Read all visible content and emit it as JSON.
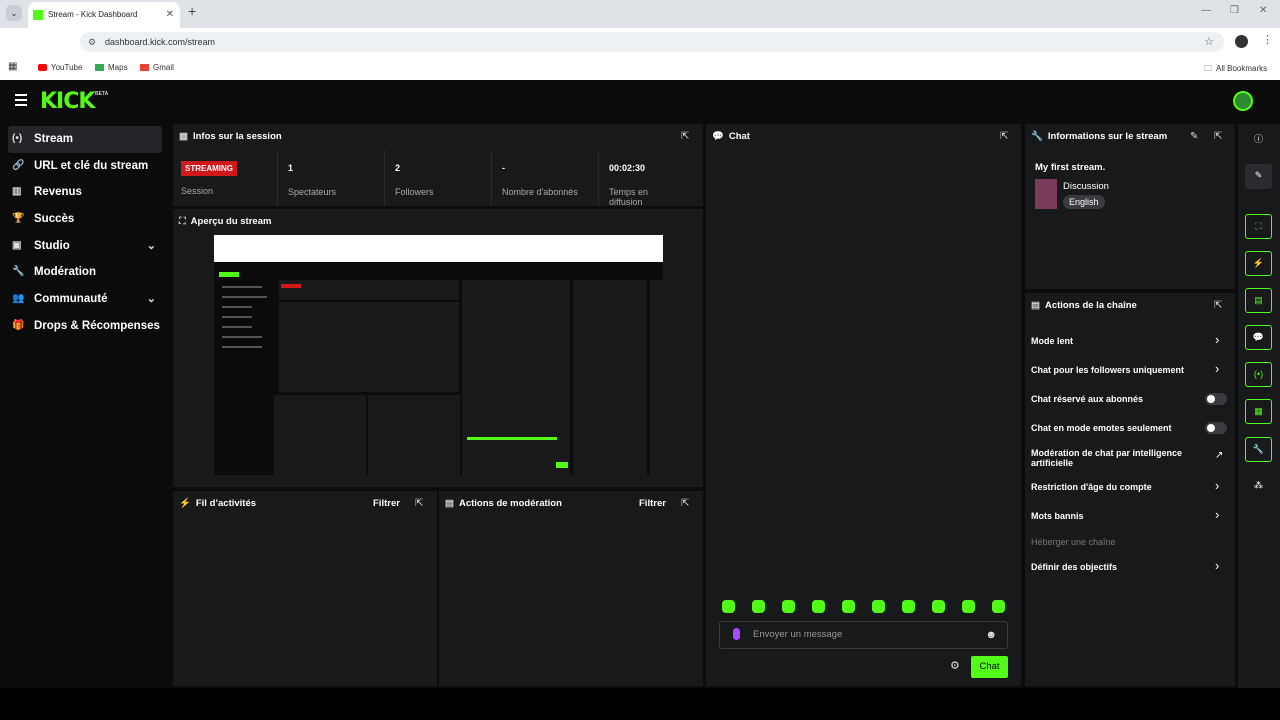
{
  "browser": {
    "tab_title": "Stream - Kick Dashboard",
    "url": "dashboard.kick.com/stream",
    "bookmarks": [
      "YouTube",
      "Maps",
      "Gmail"
    ],
    "all_bookmarks": "All Bookmarks"
  },
  "brand": {
    "logo": "KICK",
    "beta": "BETA",
    "accent": "#53fc18"
  },
  "sidebar": {
    "items": [
      {
        "label": "Stream",
        "icon": "broadcast-icon"
      },
      {
        "label": "URL et clé du stream",
        "icon": "link-icon"
      },
      {
        "label": "Revenus",
        "icon": "chart-icon"
      },
      {
        "label": "Succès",
        "icon": "trophy-icon"
      },
      {
        "label": "Studio",
        "icon": "studio-icon"
      },
      {
        "label": "Modération",
        "icon": "wrench-icon"
      },
      {
        "label": "Communauté",
        "icon": "community-icon"
      },
      {
        "label": "Drops & Récompenses",
        "icon": "gift-icon"
      }
    ]
  },
  "session": {
    "title": "Infos sur la session",
    "badge": "STREAMING",
    "session_label": "Session",
    "viewers_value": "1",
    "viewers_label": "Spectateurs",
    "followers_value": "2",
    "followers_label": "Followers",
    "subs_value": "-",
    "subs_label": "Nombre d'abonnés",
    "time_value": "00:02:30",
    "time_label": "Temps en diffusion"
  },
  "preview": {
    "title": "Aperçu du stream"
  },
  "activity": {
    "title": "Fil d’activités",
    "filter": "Filtrer"
  },
  "moderation": {
    "title": "Actions de modération",
    "filter": "Filtrer"
  },
  "chat": {
    "title": "Chat",
    "placeholder": "Envoyer un message",
    "send": "Chat"
  },
  "stream_info": {
    "title": "Informations sur le stream",
    "stream_title": "My first stream.",
    "category": "Discussion",
    "language": "English"
  },
  "channel_actions": {
    "title": "Actions de la chaîne",
    "items": [
      {
        "label": "Mode lent",
        "control": "arrow"
      },
      {
        "label": "Chat pour les followers uniquement",
        "control": "arrow"
      },
      {
        "label": "Chat réservé aux abonnés",
        "control": "toggle"
      },
      {
        "label": "Chat en mode emotes seulement",
        "control": "toggle"
      },
      {
        "label": "Modération de chat par intelligence artificielle",
        "control": "external"
      },
      {
        "label": "Restriction d'âge du compte",
        "control": "arrow"
      },
      {
        "label": "Mots bannis",
        "control": "arrow"
      },
      {
        "label": "Héberger une chaîne",
        "control": "none"
      },
      {
        "label": "Définir des objectifs",
        "control": "arrow"
      }
    ]
  }
}
